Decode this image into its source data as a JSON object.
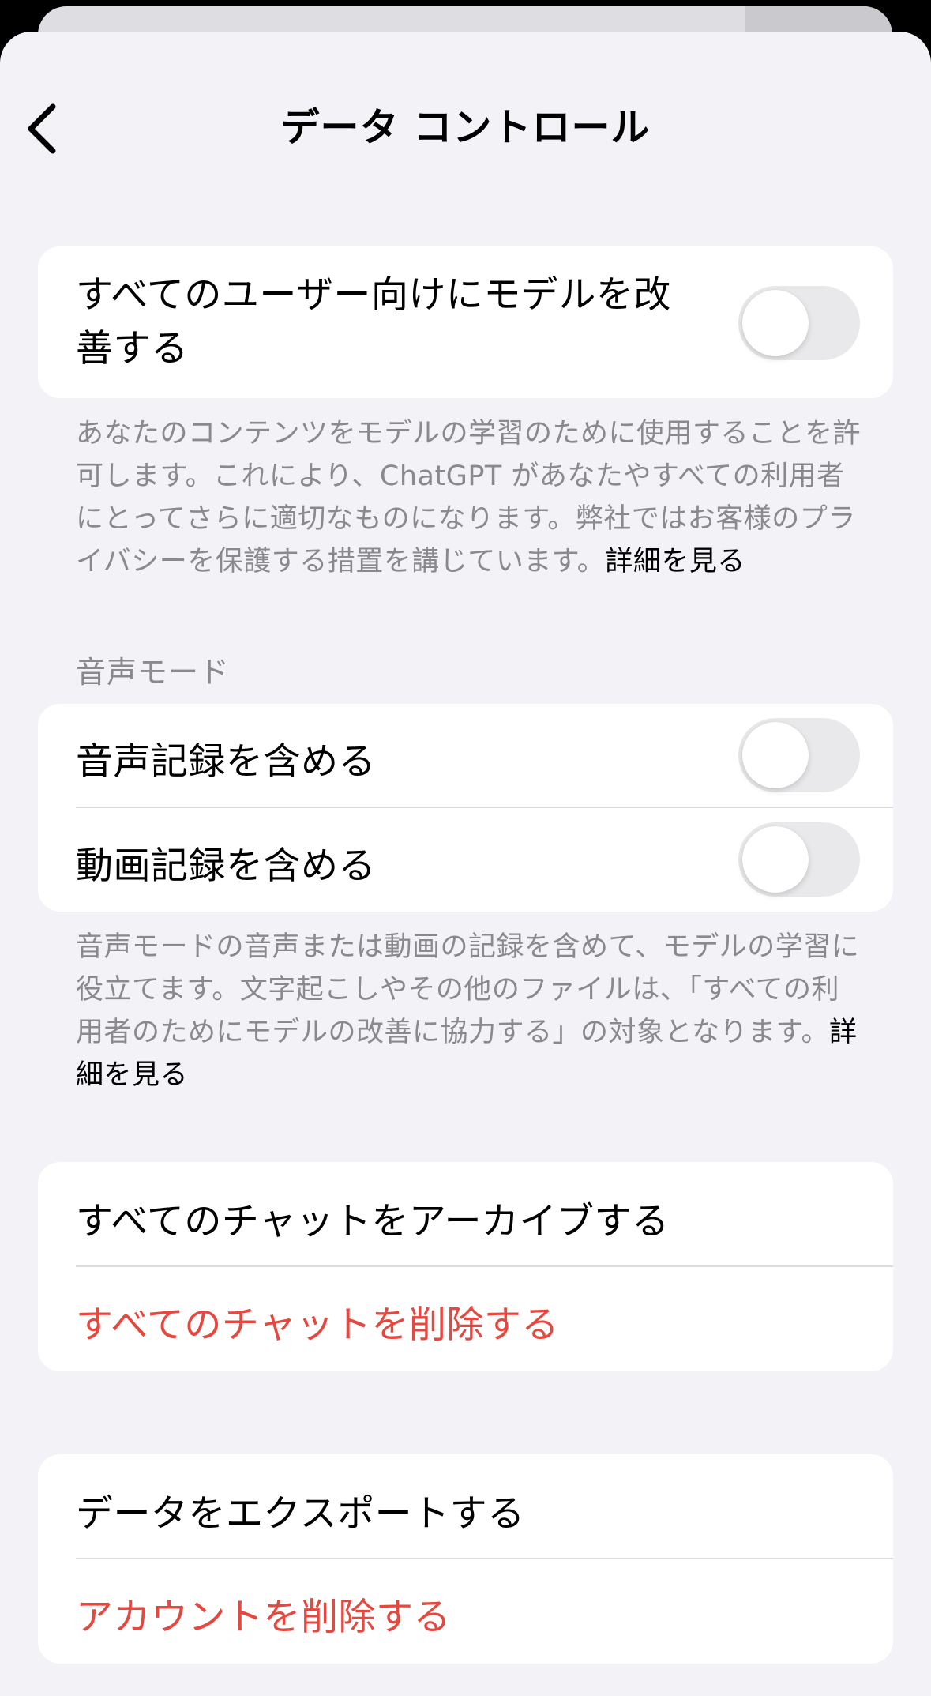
{
  "nav": {
    "title": "データ コントロール",
    "back_icon": "chevron-left-icon"
  },
  "improve_model": {
    "label": "すべてのユーザー向けにモデルを改善する",
    "toggle_on": false,
    "description": "あなたのコンテンツをモデルの学習のために使用することを許可します。これにより、ChatGPT があなたやすべての利用者にとってさらに適切なものになります。弊社ではお客様のプライバシーを保護する措置を講じています。",
    "link": "詳細を見る"
  },
  "voice_mode": {
    "header": "音声モード",
    "include_audio_label": "音声記録を含める",
    "include_audio_on": false,
    "include_video_label": "動画記録を含める",
    "include_video_on": false,
    "description": "音声モードの音声または動画の記録を含めて、モデルの学習に役立てます。文字起こしやその他のファイルは、「すべての利用者のためにモデルの改善に協力する」の対象となります。",
    "link": "詳細を見る"
  },
  "chats": {
    "archive_label": "すべてのチャットをアーカイブする",
    "delete_label": "すべてのチャットを削除する"
  },
  "account": {
    "export_label": "データをエクスポートする",
    "delete_label": "アカウントを削除する"
  },
  "colors": {
    "background": "#f2f2f7",
    "card": "#ffffff",
    "danger": "#e5483f",
    "secondary_text": "#8a8a8e",
    "toggle_off": "#e9e9eb"
  }
}
